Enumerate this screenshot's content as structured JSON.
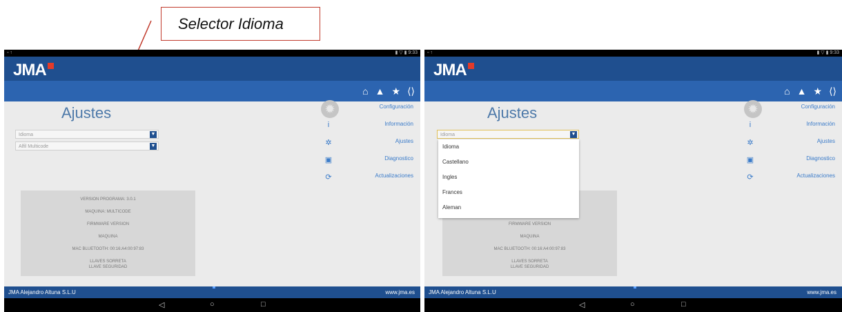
{
  "callout": {
    "label": "Selector Idioma"
  },
  "status_bar": {
    "left": "▫ ↑",
    "right": "▮ ▽ ▮ 9:33"
  },
  "brand": {
    "logo": "JMA"
  },
  "toolbar_icons": [
    {
      "name": "home-icon",
      "glyph": "⌂"
    },
    {
      "name": "user-icon",
      "glyph": "▲"
    },
    {
      "name": "star-icon",
      "glyph": "★"
    },
    {
      "name": "bluetooth-icon",
      "glyph": "⟨⟩"
    }
  ],
  "page": {
    "title": "Ajustes"
  },
  "settings": {
    "language_field": {
      "value": "Idioma"
    },
    "machine_field": {
      "value": "Alfil Multicode"
    }
  },
  "info_box": {
    "lines": [
      "VERSION PROGRAMA: 3.0.1",
      "MAQUINA: MULTICODE",
      "FIRMWARE VERSION",
      "MAQUINA",
      "MAC BLUETOOTH: 00:16:A4:00:97:83",
      "LLAVES SORRETA",
      "LLAVE SEGURIDAD"
    ]
  },
  "sidebar": {
    "items": [
      {
        "label": "Configuración",
        "icon": "gear-icon"
      },
      {
        "label": "Información",
        "icon": "info-icon"
      },
      {
        "label": "Ajustes",
        "icon": "settings-icon"
      },
      {
        "label": "Diagnostico",
        "icon": "diagnostic-icon"
      },
      {
        "label": "Actualizaciones",
        "icon": "refresh-icon"
      }
    ]
  },
  "footer": {
    "company": "JMA Alejandro Altuna S.L.U",
    "website": "www.jma.es"
  },
  "navbar": {
    "back": "◁",
    "home": "○",
    "recent": "□"
  },
  "language_dropdown": {
    "options": [
      "Idioma",
      "Castellano",
      "Ingles",
      "Frances",
      "Aleman"
    ]
  },
  "colors": {
    "brand": "#1f4f8f",
    "toolbar": "#2c64b0",
    "link": "#3a7bc9",
    "callout_border": "#c0392b"
  }
}
